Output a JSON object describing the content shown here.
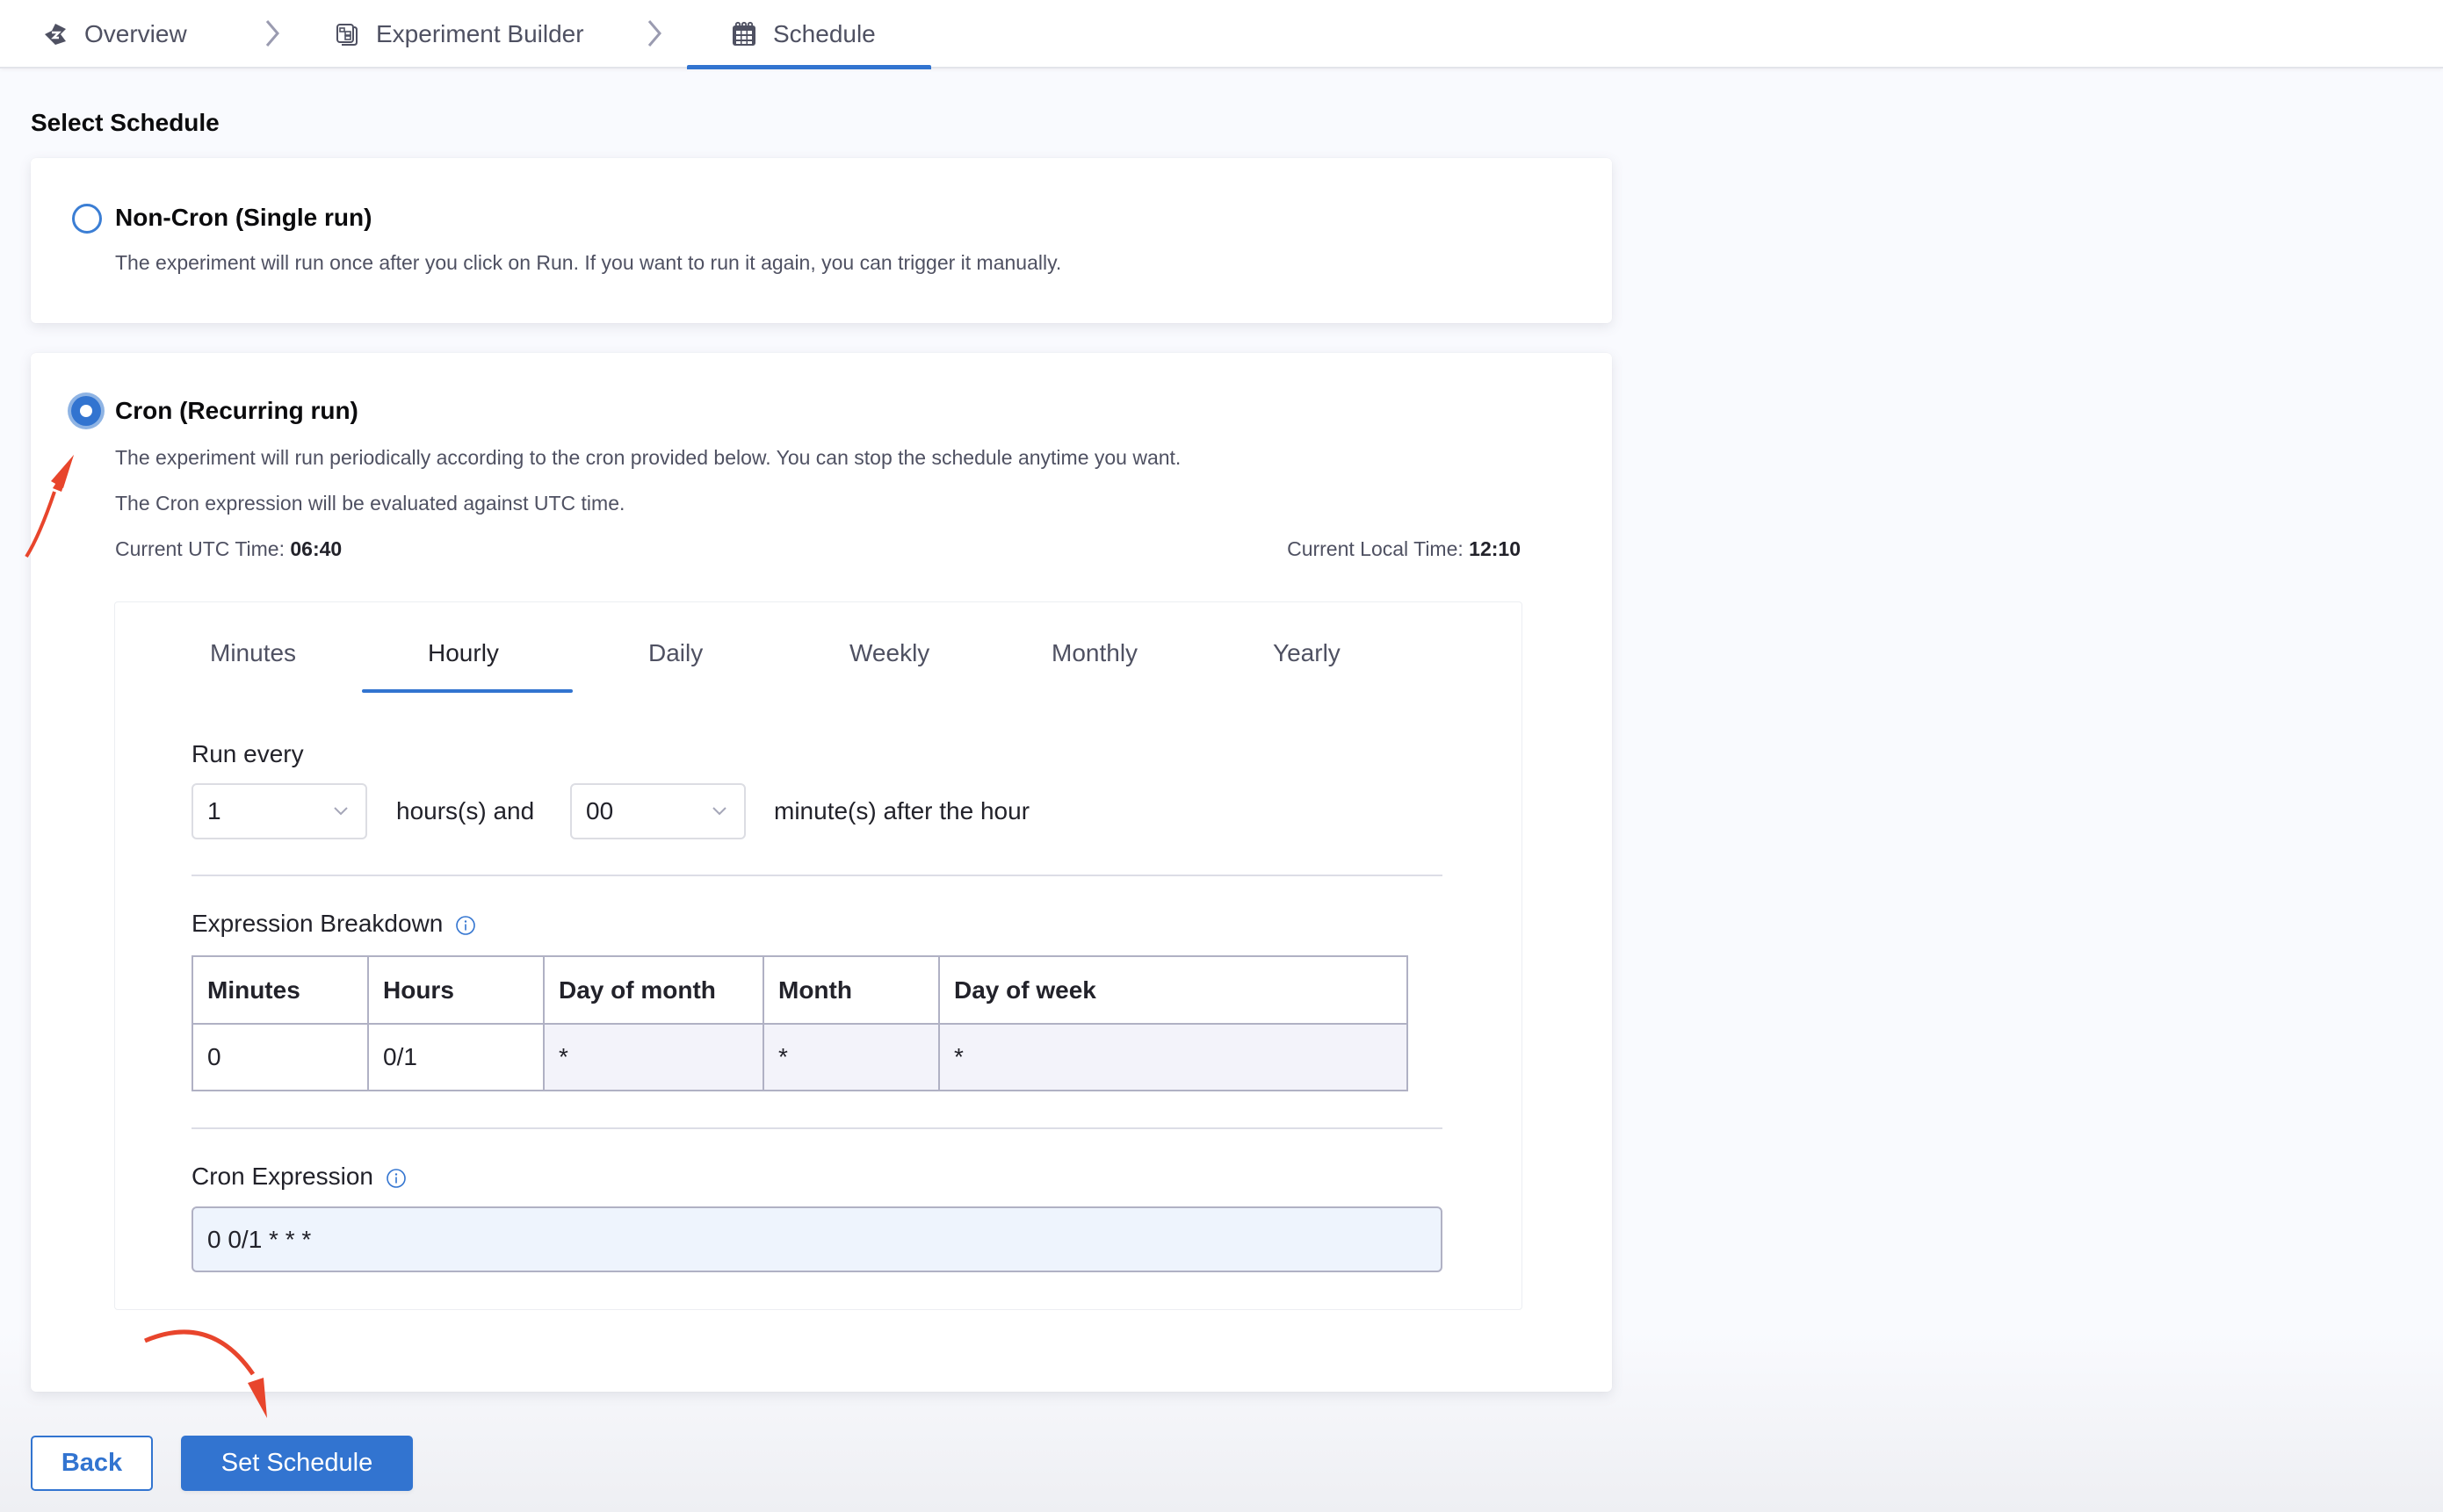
{
  "breadcrumb": {
    "items": [
      {
        "label": "Overview",
        "icon": "chaos-hub-icon"
      },
      {
        "label": "Experiment Builder",
        "icon": "experiment-builder-icon"
      },
      {
        "label": "Schedule",
        "icon": "calendar-icon",
        "active": true
      }
    ]
  },
  "page": {
    "section_title": "Select Schedule"
  },
  "options": {
    "non_cron": {
      "title": "Non-Cron (Single run)",
      "description": "The experiment will run once after you click on Run. If you want to run it again, you can trigger it manually.",
      "selected": false
    },
    "cron": {
      "title": "Cron (Recurring run)",
      "description": "The experiment will run periodically according to the cron provided below. You can stop the schedule anytime you want.",
      "utc_note": "The Cron expression will be evaluated against UTC time.",
      "selected": true,
      "utc_time_label": "Current UTC Time:",
      "utc_time": "06:40",
      "local_time_label": "Current Local Time:",
      "local_time": "12:10"
    }
  },
  "frequency_tabs": {
    "items": [
      "Minutes",
      "Hourly",
      "Daily",
      "Weekly",
      "Monthly",
      "Yearly"
    ],
    "active": "Hourly"
  },
  "run_every": {
    "label": "Run every",
    "hours_value": "1",
    "hours_suffix": "hours(s) and",
    "minutes_value": "00",
    "minutes_suffix": "minute(s) after the hour"
  },
  "expression_breakdown": {
    "title": "Expression Breakdown",
    "headers": [
      "Minutes",
      "Hours",
      "Day of month",
      "Month",
      "Day of week"
    ],
    "values": [
      "0",
      "0/1",
      "*",
      "*",
      "*"
    ]
  },
  "cron_expression": {
    "label": "Cron Expression",
    "value": "0 0/1 * * *"
  },
  "actions": {
    "back_label": "Back",
    "set_schedule_label": "Set Schedule"
  },
  "colors": {
    "accent": "#3274d0",
    "annotation_arrow": "#e8452c"
  }
}
